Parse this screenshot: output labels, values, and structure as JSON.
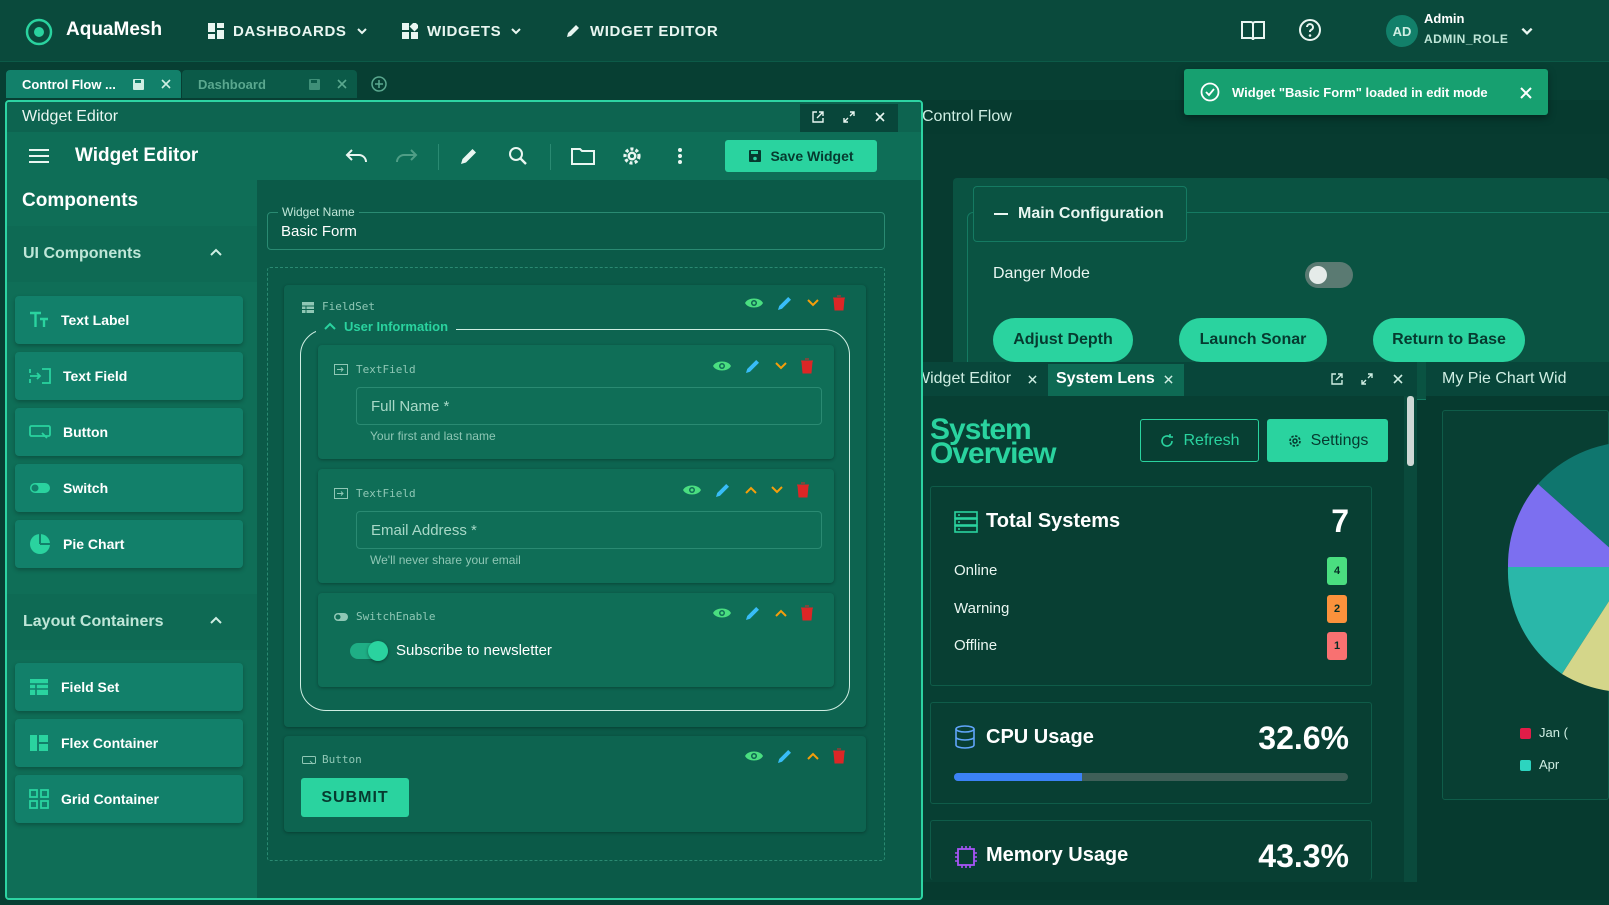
{
  "app": {
    "name": "AquaMesh"
  },
  "nav": {
    "dashboards": "DASHBOARDS",
    "widgets": "WIDGETS",
    "widget_editor": "WIDGET EDITOR"
  },
  "user": {
    "initials": "AD",
    "name": "Admin",
    "role": "ADMIN_ROLE"
  },
  "tabs": [
    {
      "label": "Control Flow ..."
    },
    {
      "label": "Dashboard"
    }
  ],
  "toast": {
    "message": "Widget \"Basic Form\" loaded in edit mode"
  },
  "editor": {
    "window_title": "Widget Editor",
    "toolbar_title": "Widget Editor",
    "save_label": "Save Widget",
    "palette": {
      "title": "Components",
      "ui_section": "UI Components",
      "ui_items": [
        {
          "label": "Text Label"
        },
        {
          "label": "Text Field"
        },
        {
          "label": "Button"
        },
        {
          "label": "Switch"
        },
        {
          "label": "Pie Chart"
        }
      ],
      "layout_section": "Layout Containers",
      "layout_items": [
        {
          "label": "Field Set"
        },
        {
          "label": "Flex Container"
        },
        {
          "label": "Grid Container"
        }
      ]
    },
    "widget_name_label": "Widget Name",
    "widget_name_value": "Basic Form",
    "fieldset": {
      "type": "FieldSet",
      "legend": "User Information"
    },
    "fields": [
      {
        "type": "TextField",
        "label": "Full Name *",
        "help": "Your first and last name"
      },
      {
        "type": "TextField",
        "label": "Email Address *",
        "help": "We'll never share your email"
      }
    ],
    "switch": {
      "type": "SwitchEnable",
      "label": "Subscribe to newsletter",
      "enabled": true
    },
    "button": {
      "type": "Button",
      "label": "SUBMIT"
    }
  },
  "control_flow": {
    "title": "Control Flow",
    "config_title": "Main Configuration",
    "danger_mode_label": "Danger Mode",
    "danger_mode_on": false,
    "buttons": [
      {
        "label": "Adjust Depth"
      },
      {
        "label": "Launch Sonar"
      },
      {
        "label": "Return to Base"
      }
    ]
  },
  "lens_tabs": [
    {
      "label": "Widget Editor"
    },
    {
      "label": "System Lens"
    }
  ],
  "pie_panel_title": "My Pie Chart Wid",
  "system_lens": {
    "title_line1": "System",
    "title_line2": "Overview",
    "refresh_label": "Refresh",
    "settings_label": "Settings",
    "total": {
      "title": "Total Systems",
      "count": "7",
      "rows": [
        {
          "label": "Online",
          "count": "4",
          "color": "#4ade80"
        },
        {
          "label": "Warning",
          "count": "2",
          "color": "#fb923c"
        },
        {
          "label": "Offline",
          "count": "1",
          "color": "#f87171"
        }
      ]
    },
    "cpu": {
      "title": "CPU Usage",
      "value": "32.6%",
      "fraction": 0.326
    },
    "memory": {
      "title": "Memory Usage",
      "value": "43.3%"
    }
  },
  "pie_legend": [
    {
      "label": "Jan (",
      "color": "#e11d48"
    },
    {
      "label": "Apr",
      "color": "#2dd4bf"
    }
  ],
  "colors": {
    "accent": "#2ad39f",
    "panel": "#0b5a48",
    "danger": "#dc2626"
  }
}
